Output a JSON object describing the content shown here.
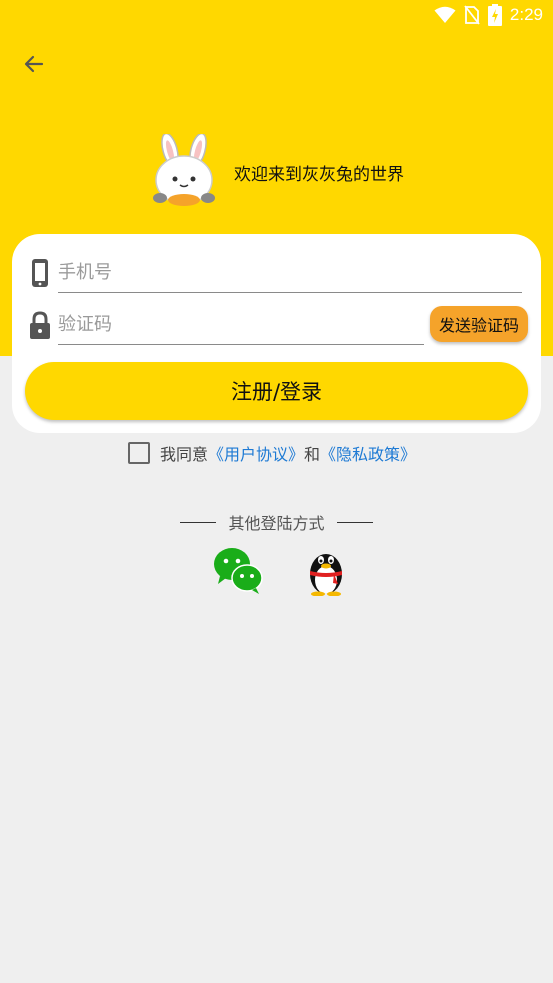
{
  "status_bar": {
    "time": "2:29"
  },
  "header": {
    "welcome": "欢迎来到灰灰兔的世界"
  },
  "form": {
    "phone_placeholder": "手机号",
    "code_placeholder": "验证码",
    "send_code_label": "发送验证码",
    "login_label": "注册/登录"
  },
  "agreement": {
    "prefix": "我同意",
    "user_agreement": "《用户协议》",
    "conjunction": "和",
    "privacy_policy": "《隐私政策》"
  },
  "other_login": {
    "title": "其他登陆方式"
  },
  "colors": {
    "brand": "#ffd800",
    "button_accent": "#f5a32a",
    "link": "#1e7ad4",
    "background": "#efefef"
  }
}
